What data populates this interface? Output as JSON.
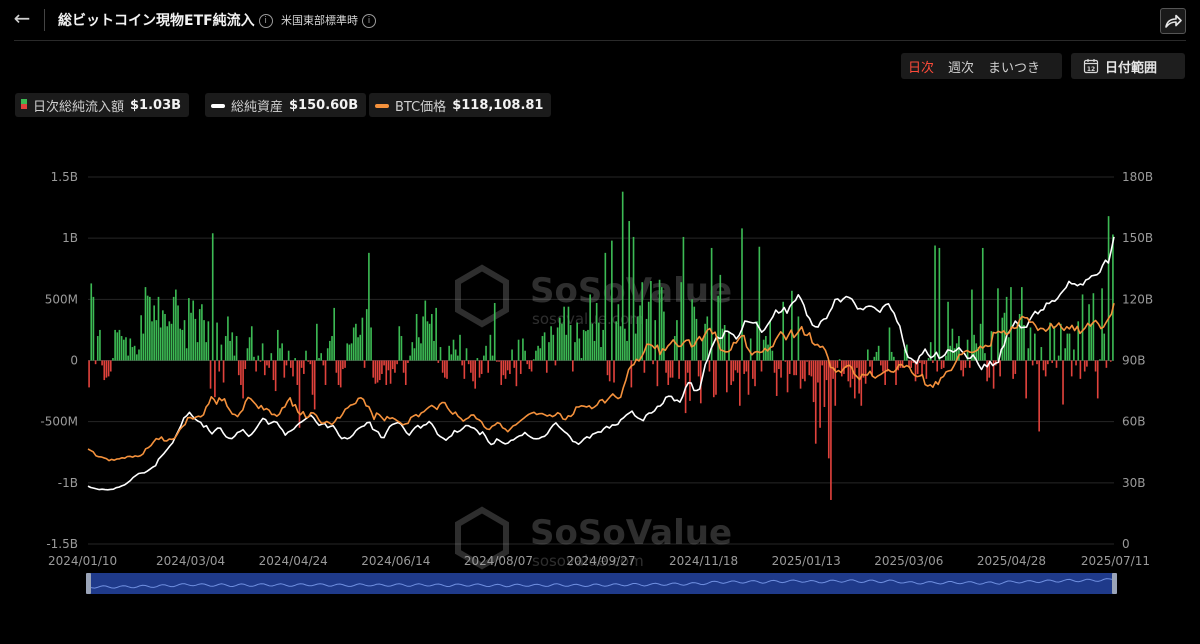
{
  "header": {
    "back_icon": "arrow-left-icon",
    "title": "総ビットコイン現物ETF純流入",
    "info_icon": "i",
    "timezone": "米国東部標準時",
    "share_icon": "share-icon"
  },
  "controls": {
    "periods": [
      "日次",
      "週次",
      "まいつき"
    ],
    "active_period": "日次",
    "date_range_label": "日付範囲",
    "date_range_icon_day": "12"
  },
  "legend": {
    "items": [
      {
        "name": "日次総純流入額",
        "value": "$1.03B",
        "colors": [
          "#3cba54",
          "#e0423c"
        ]
      },
      {
        "name": "総純資産",
        "value": "$150.60B",
        "colors": [
          "#ffffff"
        ]
      },
      {
        "name": "BTC価格",
        "value": "$118,108.81",
        "colors": [
          "#f4913c"
        ]
      }
    ]
  },
  "chart_data": {
    "type": "bar",
    "x_tick_labels": [
      "2024/01/10",
      "2024/03/04",
      "2024/04/24",
      "2024/06/14",
      "2024/08/07",
      "2024/09/27",
      "2024/11/18",
      "2025/01/13",
      "2025/03/06",
      "2025/04/28",
      "2025/07/11"
    ],
    "y_left": {
      "range": [
        -1500000000,
        1500000000
      ],
      "tick_labels": [
        "1.5B",
        "1B",
        "500M",
        "0",
        "-500M",
        "-1B",
        "-1.5B"
      ]
    },
    "y_right": {
      "range": [
        0,
        180000000000
      ],
      "tick_labels": [
        "180B",
        "150B",
        "120B",
        "90B",
        "60B",
        "30B",
        "0"
      ]
    },
    "grid": true,
    "watermark": {
      "brand": "SoSoValue",
      "url": "sosovalue.com"
    },
    "colors": {
      "inflow": "#3cba54",
      "outflow": "#e0423c",
      "net_assets": "#ffffff",
      "btc_price": "#f4913c",
      "navigator": "#1f3a8a"
    },
    "daily_net_inflow_millions": [
      -220,
      630,
      520,
      -30,
      200,
      250,
      -40,
      -160,
      -140,
      -130,
      -90,
      20,
      250,
      230,
      250,
      200,
      170,
      190,
      40,
      180,
      110,
      120,
      50,
      90,
      370,
      220,
      600,
      530,
      520,
      320,
      450,
      330,
      520,
      270,
      410,
      380,
      280,
      320,
      300,
      520,
      580,
      450,
      260,
      250,
      330,
      100,
      510,
      390,
      490,
      340,
      150,
      420,
      460,
      330,
      150,
      320,
      -230,
      1040,
      -300,
      310,
      -90,
      130,
      -180,
      200,
      360,
      160,
      230,
      40,
      200,
      -120,
      -200,
      -310,
      -70,
      100,
      190,
      280,
      30,
      -90,
      40,
      -10,
      140,
      -120,
      -40,
      -60,
      60,
      -160,
      -250,
      250,
      100,
      140,
      -140,
      -40,
      80,
      -60,
      -130,
      20,
      -200,
      -550,
      -60,
      -110,
      80,
      -10,
      -30,
      -280,
      -400,
      300,
      20,
      60,
      -40,
      -200,
      100,
      160,
      200,
      430,
      -100,
      -200,
      -220,
      -70,
      -60,
      140,
      130,
      140,
      270,
      300,
      190,
      210,
      350,
      -60,
      420,
      880,
      270,
      -140,
      -190,
      -180,
      -160,
      -110,
      -40,
      -200,
      -80,
      -190,
      -70,
      -100,
      -30,
      280,
      200,
      -100,
      -200,
      -20,
      40,
      150,
      100,
      380,
      190,
      140,
      360,
      490,
      320,
      300,
      380,
      160,
      430,
      -20,
      110,
      -100,
      -140,
      -150,
      120,
      50,
      170,
      90,
      40,
      210,
      -40,
      -150,
      100,
      -30,
      -100,
      -170,
      -230,
      20,
      -140,
      -110,
      40,
      120,
      -100,
      210,
      40,
      470,
      -10,
      -10,
      -200,
      -120,
      -150,
      -80,
      -110,
      90,
      -60,
      -210,
      170,
      -110,
      180,
      80,
      -30,
      -70,
      -90,
      10,
      80,
      120,
      100,
      200,
      230,
      -100,
      150,
      280,
      210,
      -40,
      270,
      350,
      300,
      440,
      210,
      440,
      290,
      -90,
      150,
      310,
      180,
      20,
      250,
      240,
      250,
      540,
      300,
      160,
      470,
      310,
      110,
      250,
      880,
      -120,
      -170,
      980,
      -180,
      320,
      460,
      280,
      1380,
      260,
      160,
      1140,
      -220,
      1010,
      220,
      360,
      450,
      640,
      -100,
      340,
      480,
      650,
      -30,
      330,
      -210,
      660,
      600,
      400,
      -100,
      -200,
      -140,
      -140,
      200,
      330,
      -150,
      640,
      1010,
      -430,
      -100,
      -330,
      500,
      440,
      340,
      -130,
      -350,
      180,
      300,
      360,
      -90,
      920,
      -300,
      -280,
      530,
      700,
      260,
      290,
      -260,
      230,
      -200,
      -170,
      -80,
      -100,
      -370,
      1080,
      -110,
      -90,
      -280,
      180,
      -150,
      -210,
      320,
      930,
      -90,
      170,
      200,
      130,
      320,
      80,
      -100,
      -290,
      -70,
      -140,
      480,
      -10,
      -260,
      -110,
      570,
      -120,
      -120,
      360,
      -230,
      -150,
      -170,
      -10,
      -120,
      -130,
      -340,
      -680,
      -180,
      -550,
      -40,
      -380,
      -160,
      -800,
      -1140,
      -150,
      -370,
      -60,
      10,
      -130,
      -110,
      -60,
      -170,
      -220,
      -150,
      -310,
      -60,
      -270,
      -370,
      -140,
      -190,
      90,
      -50,
      -130,
      30,
      70,
      120,
      -40,
      -90,
      -200,
      -90,
      270,
      70,
      30,
      -200,
      -80,
      -60,
      -60,
      90,
      130,
      -60,
      -60,
      -20,
      -170,
      -110,
      -20,
      -130,
      -30,
      -150,
      20,
      150,
      -20,
      940,
      -90,
      920,
      -70,
      -60,
      40,
      480,
      120,
      260,
      100,
      140,
      200,
      -80,
      -130,
      -60,
      170,
      -60,
      580,
      210,
      140,
      110,
      300,
      920,
      60,
      -170,
      -140,
      240,
      -230,
      -40,
      590,
      -130,
      350,
      390,
      520,
      190,
      600,
      -150,
      -110,
      300,
      380,
      600,
      290,
      -310,
      100,
      270,
      -40,
      220,
      -30,
      -580,
      110,
      -80,
      -130,
      -30,
      310,
      -20,
      280,
      -60,
      40,
      300,
      -360,
      100,
      220,
      220,
      -130,
      90,
      -40,
      320,
      -150,
      540,
      -90,
      -50,
      460,
      300,
      550,
      -90,
      -310,
      10,
      590,
      220,
      -60,
      1180,
      -10,
      1030
    ],
    "total_net_assets_billions": [
      28.4,
      27.7,
      27.4,
      27.0,
      26.7,
      26.9,
      26.7,
      26.6,
      26.8,
      26.9,
      27.6,
      27.9,
      28.5,
      29.0,
      30.0,
      31.1,
      32.6,
      33.6,
      34.6,
      34.8,
      34.9,
      35.7,
      36.7,
      37.7,
      38.4,
      41.6,
      43.0,
      44.5,
      46.2,
      48.0,
      49.6,
      52.6,
      55.3,
      58.1,
      61.8,
      62.9,
      64.6,
      62.8,
      61.3,
      60.3,
      59.7,
      57.4,
      58.0,
      55.6,
      54.0,
      55.6,
      56.9,
      56.8,
      54.4,
      52.6,
      51.9,
      51.7,
      52.8,
      54.7,
      55.2,
      56.1,
      54.4,
      52.8,
      53.8,
      55.4,
      57.4,
      59.6,
      61.6,
      61.0,
      58.8,
      59.4,
      60.1,
      59.7,
      57.5,
      55.9,
      53.4,
      54.9,
      55.5,
      56.4,
      58.0,
      59.3,
      60.1,
      61.1,
      62.2,
      63.2,
      61.9,
      59.8,
      58.2,
      58.8,
      59.1,
      57.1,
      57.7,
      58.0,
      56.0,
      53.4,
      51.7,
      52.2,
      51.6,
      52.2,
      53.5,
      55.5,
      56.7,
      57.5,
      57.9,
      59.5,
      59.7,
      56.3,
      55.6,
      54.9,
      52.3,
      52.2,
      55.1,
      57.6,
      58.6,
      59.1,
      59.6,
      58.8,
      56.8,
      54.6,
      53.4,
      55.4,
      57.1,
      58.1,
      56.9,
      58.2,
      58.6,
      60.1,
      58.8,
      56.7,
      53.8,
      52.7,
      51.9,
      50.9,
      52.3,
      53.1,
      55.6,
      54.9,
      55.5,
      56.7,
      58.1,
      58.0,
      57.2,
      56.8,
      55.6,
      53.7,
      55.0,
      52.9,
      50.2,
      48.8,
      49.3,
      51.5,
      50.7,
      49.8,
      49.1,
      49.5,
      50.8,
      51.1,
      52.2,
      53.0,
      53.3,
      54.7,
      53.4,
      52.5,
      51.7,
      51.6,
      51.7,
      52.5,
      52.8,
      54.1,
      56.5,
      58.3,
      59.4,
      57.7,
      56.4,
      55.1,
      54.1,
      52.6,
      50.3,
      50.0,
      48.9,
      50.1,
      51.6,
      52.6,
      52.0,
      53.8,
      54.4,
      55.0,
      54.9,
      56.6,
      57.7,
      56.9,
      58.4,
      58.3,
      58.7,
      60.9,
      61.9,
      63.3,
      64.2,
      65.2,
      63.0,
      61.9,
      61.2,
      60.5,
      63.1,
      64.2,
      64.3,
      65.4,
      67.5,
      67.7,
      69.0,
      71.9,
      72.5,
      72.4,
      70.3,
      70.6,
      69.6,
      72.4,
      76.7,
      79.1,
      78.9,
      75.3,
      75.3,
      76.0,
      82.0,
      88.1,
      91.1,
      95.6,
      98.6,
      101.6,
      100.9,
      101.1,
      104.4,
      104.3,
      103.4,
      102.6,
      100.6,
      102.3,
      105.3,
      109.3,
      109.1,
      108.7,
      108.4,
      108.7,
      106.3,
      103.9,
      105.1,
      107.3,
      109.3,
      111.5,
      114.7,
      113.3,
      114.0,
      116.0,
      113.2,
      116.6,
      118.4,
      119.5,
      122.2,
      120.0,
      117.1,
      112.2,
      110.6,
      107.4,
      106.6,
      106.4,
      109.2,
      110.3,
      110.6,
      113.6,
      115.9,
      119.9,
      120.2,
      118.8,
      120.3,
      121.4,
      120.9,
      120.1,
      117.9,
      115.3,
      115.5,
      114.9,
      116.3,
      116.7,
      116.6,
      115.9,
      114.7,
      113.7,
      116.2,
      117.4,
      117.8,
      115.0,
      113.2,
      109.2,
      106.9,
      100.7,
      95.1,
      91.5,
      91.0,
      89.9,
      88.5,
      92.1,
      93.3,
      95.6,
      93.0,
      91.3,
      92.1,
      94.0,
      91.1,
      91.7,
      92.8,
      95.2,
      94.9,
      94.1,
      95.0,
      96.3,
      94.5,
      93.3,
      91.1,
      91.1,
      92.7,
      90.6,
      87.8,
      85.6,
      88.1,
      86.9,
      89.5,
      87.5,
      88.7,
      89.1,
      95.4,
      97.4,
      102.6,
      104.4,
      106.7,
      109.3,
      107.8,
      106.1,
      106.3,
      106.4,
      109.6,
      112.0,
      114.1,
      112.9,
      114.6,
      114.9,
      118.1,
      118.0,
      119.3,
      119.1,
      120.5,
      122.6,
      124.3,
      125.8,
      128.8,
      127.6,
      127.6,
      126.7,
      127.5,
      127.1,
      129.5,
      130.0,
      131.5,
      131.8,
      132.1,
      133.3,
      136.8,
      139.2,
      137.8,
      144.0,
      150.6
    ],
    "btc_price_thousand_usd": [
      46.6,
      45.9,
      45.2,
      43.3,
      42.8,
      42.7,
      42.3,
      41.9,
      40.9,
      41.5,
      41.1,
      41.7,
      41.8,
      42.3,
      42.1,
      42.9,
      43.0,
      42.6,
      43.2,
      42.9,
      43.3,
      44.2,
      46.7,
      47.3,
      48.3,
      50.1,
      51.7,
      51.3,
      52.5,
      50.6,
      50.5,
      51.5,
      51.3,
      51.8,
      53.8,
      56.1,
      57.6,
      58.6,
      61.9,
      62.1,
      61.3,
      62.2,
      62.7,
      62.4,
      63.4,
      67.2,
      68.7,
      72.2,
      70.9,
      68.6,
      71.6,
      70.3,
      71.2,
      67.6,
      65.7,
      63.7,
      63.5,
      62.5,
      64.4,
      65.7,
      69.8,
      71.9,
      71.2,
      69.8,
      68.4,
      66.5,
      67.9,
      65.8,
      66.4,
      65.6,
      63.5,
      63.6,
      62.7,
      63.8,
      66.7,
      67.2,
      69.9,
      71.7,
      67.7,
      68.3,
      64.7,
      63.4,
      64.9,
      62.1,
      62.2,
      64.4,
      64.2,
      63.1,
      60.8,
      59.2,
      59.4,
      60.1,
      59.4,
      58.6,
      60.0,
      62.0,
      61.8,
      63.6,
      66.1,
      66.8,
      68.1,
      68.4,
      69.0,
      71.4,
      71.7,
      70.9,
      67.8,
      67.4,
      64.7,
      61.1,
      64.2,
      63.4,
      62.0,
      60.5,
      62.5,
      61.5,
      61.9,
      61.2,
      60.3,
      59.5,
      58.4,
      58.9,
      59.2,
      62.0,
      62.8,
      63.4,
      62.5,
      64.3,
      64.9,
      66.1,
      67.2,
      68.0,
      67.1,
      66.0,
      68.4,
      69.4,
      69.3,
      66.8,
      65.1,
      63.7,
      64.7,
      62.7,
      61.7,
      60.3,
      61.2,
      61.9,
      63.2,
      63.3,
      61.5,
      60.9,
      59.9,
      57.5,
      56.4,
      56.2,
      57.8,
      58.3,
      59.5,
      59.1,
      57.0,
      56.4,
      55.1,
      56.5,
      57.9,
      58.4,
      59.5,
      60.6,
      61.6,
      62.7,
      63.6,
      64.2,
      64.6,
      63.5,
      63.9,
      64.0,
      63.4,
      62.8,
      63.3,
      62.5,
      63.1,
      64.4,
      63.7,
      61.3,
      61.0,
      62.9,
      62.6,
      63.8,
      67.2,
      67.2,
      67.8,
      67.6,
      67.2,
      67.8,
      66.4,
      67.2,
      68.2,
      70.4,
      70.8,
      69.2,
      70.8,
      72.3,
      73.6,
      72.3,
      71.3,
      72.0,
      76.7,
      80.4,
      85.5,
      87.3,
      88.0,
      90.6,
      89.8,
      91.9,
      94.4,
      98.0,
      97.9,
      97.3,
      95.9,
      97.5,
      93.0,
      95.7,
      95.0,
      97.1,
      98.4,
      100.1,
      98.4,
      96.9,
      97.0,
      98.9,
      99.9,
      100.1,
      96.7,
      97.4,
      100.0,
      101.7,
      99.7,
      102.5,
      104.9,
      105.7,
      103.1,
      103.9,
      99.3,
      95.2,
      94.8,
      94.2,
      94.3,
      95.3,
      98.8,
      98.6,
      100.6,
      102.0,
      102.2,
      96.7,
      94.8,
      92.8,
      94.0,
      94.4,
      93.9,
      94.2,
      95.9,
      94.7,
      96.4,
      96.9,
      100.0,
      102.1,
      104.1,
      102.7,
      100.2,
      102.6,
      104.9,
      101.3,
      102.8,
      104.6,
      106.6,
      102.6,
      102.3,
      103.6,
      98.8,
      97.6,
      97.9,
      96.5,
      96.9,
      95.0,
      91.4,
      86.6,
      86.3,
      84.3,
      85.1,
      84.1,
      86.1,
      87.2,
      87.7,
      86.7,
      83.5,
      82.1,
      80.7,
      83.2,
      82.9,
      82.9,
      84.7,
      82.3,
      81.4,
      82.4,
      83.1,
      84.0,
      84.8,
      85.5,
      84.5,
      84.3,
      85.5,
      87.9,
      88.0,
      86.7,
      87.5,
      86.9,
      84.1,
      82.7,
      82.1,
      82.4,
      83.1,
      78.2,
      77.5,
      78.1,
      76.9,
      79.6,
      78.3,
      81.4,
      82.1,
      84.4,
      84.9,
      85.2,
      87.4,
      90.0,
      92.9,
      93.0,
      94.3,
      94.9,
      94.1,
      93.9,
      94.4,
      95.1,
      97.0,
      96.1,
      97.4,
      96.9,
      97.2,
      103.7,
      103.5,
      104.3,
      103.7,
      104.5,
      102.7,
      103.5,
      106.5,
      105.8,
      106.1,
      109.8,
      111.6,
      111.0,
      110.9,
      108.8,
      108.9,
      107.2,
      104.8,
      105.8,
      105.6,
      104.4,
      105.6,
      108.0,
      105.9,
      106.9,
      108.4,
      106.2,
      104.8,
      106.6,
      105.5,
      107.2,
      104.7,
      106.7,
      103.3,
      104.6,
      106.0,
      108.2,
      106.9,
      108.6,
      109.6,
      108.0,
      105.7,
      106.4,
      108.7,
      110.8,
      112.7,
      118.1
    ]
  }
}
